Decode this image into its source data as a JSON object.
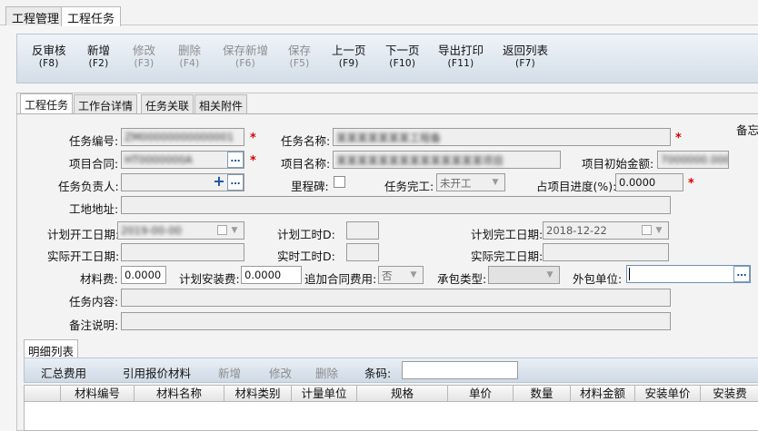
{
  "doc_tabs": [
    "工程管理",
    "工程任务"
  ],
  "toolbar": [
    {
      "label": "反审核",
      "key": "(F8)",
      "enabled": true
    },
    {
      "label": "新增",
      "key": "(F2)",
      "enabled": true
    },
    {
      "label": "修改",
      "key": "(F3)",
      "enabled": false
    },
    {
      "label": "删除",
      "key": "(F4)",
      "enabled": false
    },
    {
      "label": "保存新增",
      "key": "(F6)",
      "enabled": false
    },
    {
      "label": "保存",
      "key": "(F5)",
      "enabled": false
    },
    {
      "label": "上一页",
      "key": "(F9)",
      "enabled": true
    },
    {
      "label": "下一页",
      "key": "(F10)",
      "enabled": true
    },
    {
      "label": "导出打印",
      "key": "(F11)",
      "enabled": true
    },
    {
      "label": "返回列表",
      "key": "(F7)",
      "enabled": true
    }
  ],
  "sub_tabs": [
    "工程任务",
    "工作台详情",
    "任务关联",
    "相关附件"
  ],
  "form": {
    "side_label": "备忘",
    "task_no": {
      "label": "任务编号:",
      "value": "ZM00000000000001"
    },
    "task_name": {
      "label": "任务名称:",
      "value": "某某某某某某某工程备"
    },
    "project_contract": {
      "label": "项目合同:",
      "value": "HT0000000A"
    },
    "project_name": {
      "label": "项目名称:",
      "value": "某某某某某某某某某某某某某某项目"
    },
    "initial_amount": {
      "label": "项目初始金额:",
      "value": "7000000.0000"
    },
    "task_owner": {
      "label": "任务负责人:",
      "value": ""
    },
    "milestone": {
      "label": "里程碑:",
      "checked": false
    },
    "task_complete": {
      "label": "任务完工:",
      "value": "未开工"
    },
    "progress_ratio": {
      "label": "占项目进度(%):",
      "value": "0.0000"
    },
    "site_address": {
      "label": "工地地址:",
      "value": ""
    },
    "plan_start": {
      "label": "计划开工日期:",
      "value": "2019-00-00"
    },
    "plan_hours": {
      "label": "计划工时D:",
      "value": ""
    },
    "plan_finish": {
      "label": "计划完工日期:",
      "value": "2018-12-22"
    },
    "actual_start": {
      "label": "实际开工日期:",
      "value": ""
    },
    "actual_hours": {
      "label": "实时工时D:",
      "value": ""
    },
    "actual_finish": {
      "label": "实际完工日期:",
      "value": ""
    },
    "material_fee": {
      "label": "材料费:",
      "value": "0.0000"
    },
    "plan_install_fee": {
      "label": "计划安装费:",
      "value": "0.0000"
    },
    "add_contract_fee": {
      "label": "追加合同费用:",
      "value": "否"
    },
    "contract_type": {
      "label": "承包类型:",
      "value": ""
    },
    "subcontractor": {
      "label": "外包单位:",
      "value": ""
    },
    "task_content": {
      "label": "任务内容:",
      "value": ""
    },
    "remark": {
      "label": "备注说明:",
      "value": ""
    }
  },
  "detail": {
    "tab": "明细列表",
    "buttons": [
      {
        "label": "汇总费用",
        "enabled": true
      },
      {
        "label": "引用报价材料",
        "enabled": true
      },
      {
        "label": "新增",
        "enabled": false
      },
      {
        "label": "修改",
        "enabled": false
      },
      {
        "label": "删除",
        "enabled": false
      }
    ],
    "barcode_label": "条码:",
    "barcode_value": "",
    "columns": [
      "",
      "材料编号",
      "材料名称",
      "材料类别",
      "计量单位",
      "规格",
      "单价",
      "数量",
      "材料金额",
      "安装单价",
      "安装费"
    ]
  },
  "colors": {
    "required": "#d80000",
    "toolbar_top": "#eef3f8",
    "toolbar_bottom": "#d4dee8"
  }
}
